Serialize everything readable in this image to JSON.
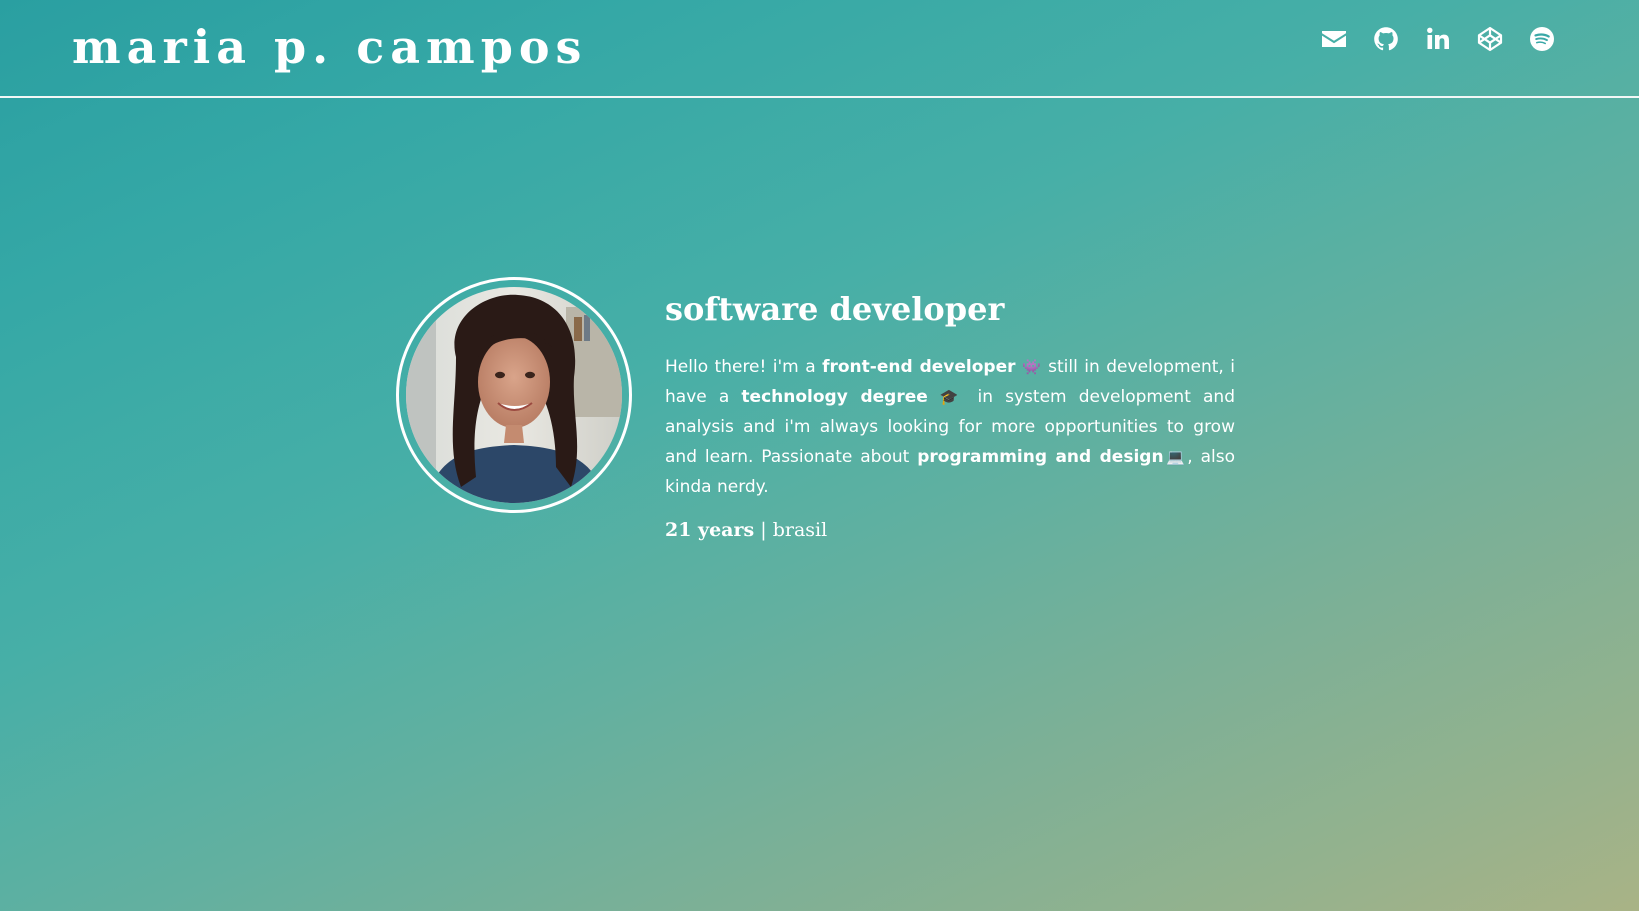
{
  "header": {
    "brand": "maria p. campos",
    "social_links": [
      {
        "name": "email",
        "icon": "envelope-icon"
      },
      {
        "name": "github",
        "icon": "github-icon"
      },
      {
        "name": "linkedin",
        "icon": "linkedin-icon"
      },
      {
        "name": "codepen",
        "icon": "codepen-icon"
      },
      {
        "name": "spotify",
        "icon": "spotify-icon"
      }
    ]
  },
  "profile": {
    "photo_alt": "portrait photo"
  },
  "about": {
    "title": "software developer",
    "bio": {
      "intro": "Hello there! i'm a ",
      "highlight1": "front-end developer",
      "emoji1": "👾",
      "text2": " still in development, i have a ",
      "highlight2": "technology degree",
      "emoji2": "🎓",
      "text3": "  in system development and analysis and i'm always looking for more opportunities to grow and learn. Passionate about ",
      "highlight3": "programming and design",
      "emoji3": "💻",
      "text4": ", also kinda nerdy."
    },
    "age": "21 years",
    "separator": "|",
    "country": "brasil"
  },
  "colors": {
    "gradient_start": "#2a9fa1",
    "gradient_end": "#a9b386",
    "text": "#ffffff"
  }
}
